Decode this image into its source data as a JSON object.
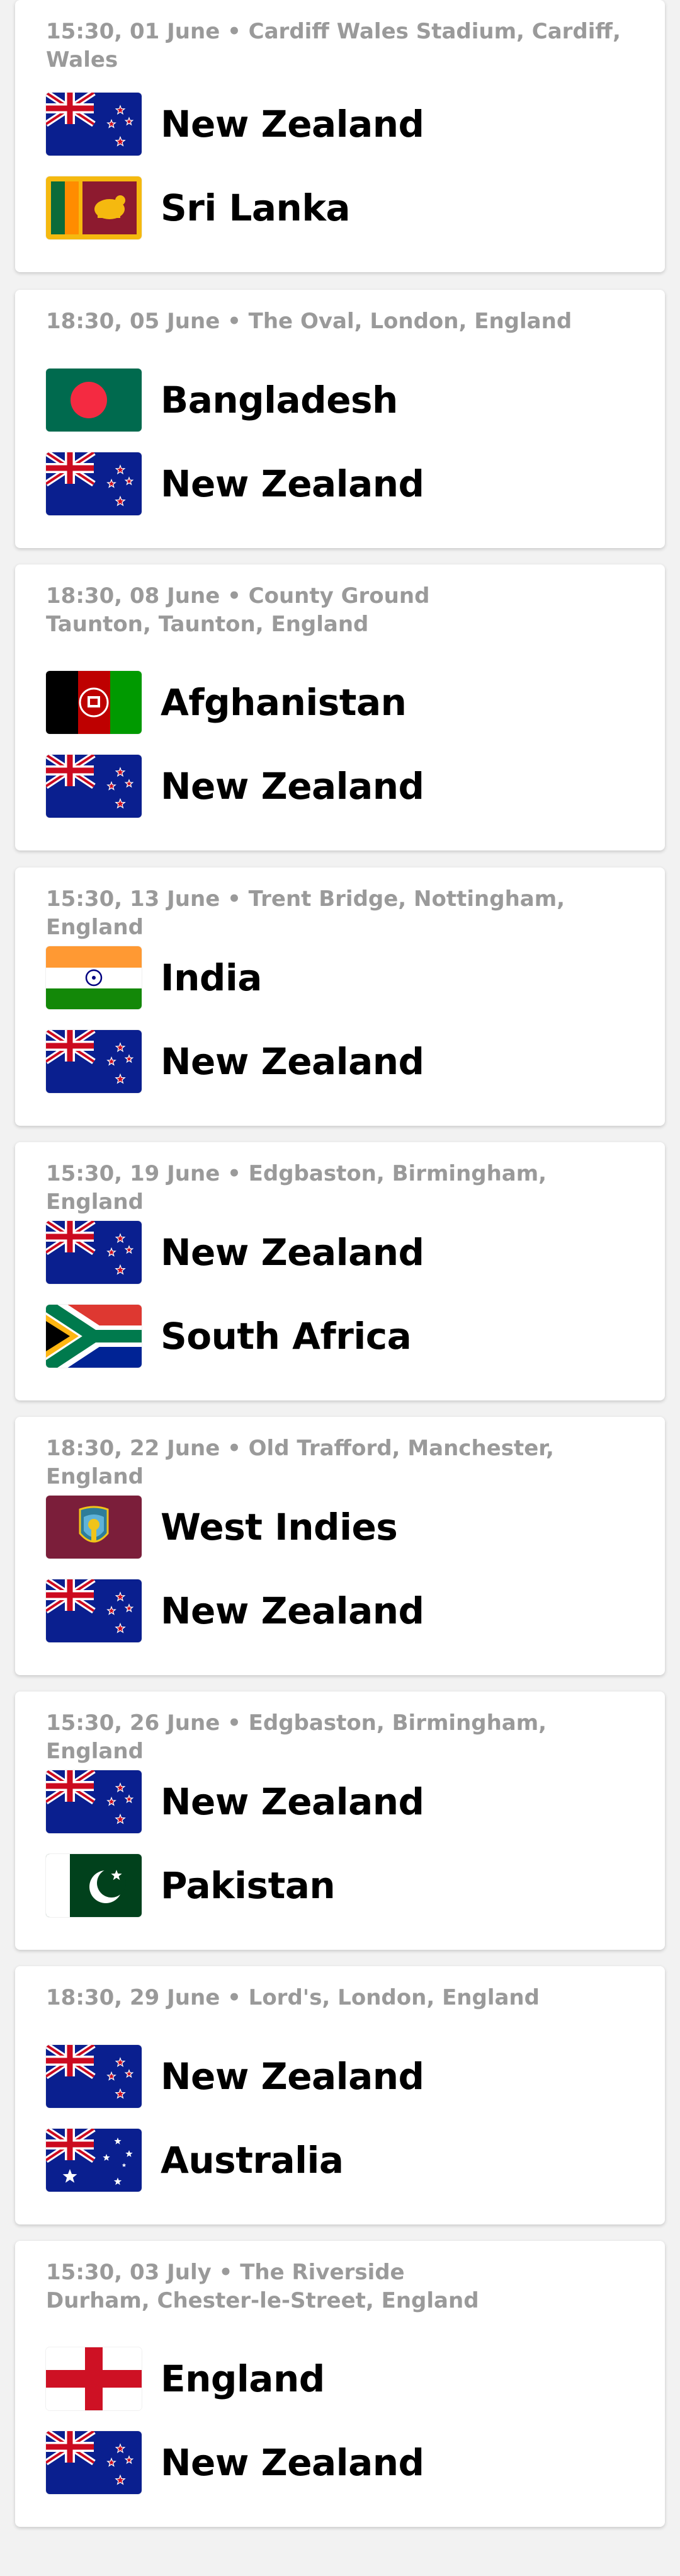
{
  "matches": [
    {
      "meta": "15:30, 01 June • Cardiff Wales Stadium, Cardiff, Wales",
      "teams": [
        {
          "name": "New Zealand",
          "flag": "new-zealand"
        },
        {
          "name": "Sri Lanka",
          "flag": "sri-lanka"
        }
      ]
    },
    {
      "meta": "18:30, 05 June • The Oval, London, England",
      "teams": [
        {
          "name": "Bangladesh",
          "flag": "bangladesh"
        },
        {
          "name": "New Zealand",
          "flag": "new-zealand"
        }
      ]
    },
    {
      "meta": "18:30, 08 June • County Ground\nTaunton, Taunton, England",
      "teams": [
        {
          "name": "Afghanistan",
          "flag": "afghanistan"
        },
        {
          "name": "New Zealand",
          "flag": "new-zealand"
        }
      ]
    },
    {
      "meta": "15:30, 13 June • Trent Bridge, Nottingham, England",
      "teams": [
        {
          "name": "India",
          "flag": "india"
        },
        {
          "name": "New Zealand",
          "flag": "new-zealand"
        }
      ]
    },
    {
      "meta": "15:30, 19 June • Edgbaston, Birmingham, England",
      "teams": [
        {
          "name": "New Zealand",
          "flag": "new-zealand"
        },
        {
          "name": "South Africa",
          "flag": "south-africa"
        }
      ]
    },
    {
      "meta": "18:30, 22 June • Old Trafford, Manchester, England",
      "teams": [
        {
          "name": "West Indies",
          "flag": "west-indies"
        },
        {
          "name": "New Zealand",
          "flag": "new-zealand"
        }
      ]
    },
    {
      "meta": "15:30, 26 June • Edgbaston, Birmingham, England",
      "teams": [
        {
          "name": "New Zealand",
          "flag": "new-zealand"
        },
        {
          "name": "Pakistan",
          "flag": "pakistan"
        }
      ]
    },
    {
      "meta": "18:30, 29 June • Lord's, London, England",
      "teams": [
        {
          "name": "New Zealand",
          "flag": "new-zealand"
        },
        {
          "name": "Australia",
          "flag": "australia"
        }
      ]
    },
    {
      "meta": "15:30, 03 July • The Riverside\nDurham, Chester-le-Street, England",
      "teams": [
        {
          "name": "England",
          "flag": "england"
        },
        {
          "name": "New Zealand",
          "flag": "new-zealand"
        }
      ]
    }
  ]
}
